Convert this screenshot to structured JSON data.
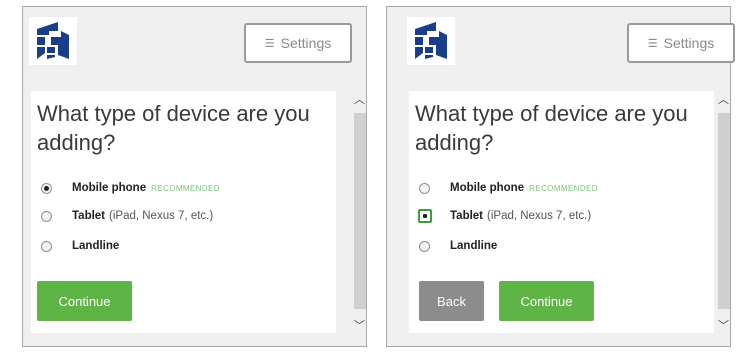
{
  "colors": {
    "primary_button": "#5fb446",
    "back_button": "#8c8c8c",
    "recommended_text": "#7cc47c",
    "logo_blue": "#1a3e8a"
  },
  "logo": {
    "icon": "duo-logo-icon"
  },
  "settings": {
    "label": "Settings",
    "icon": "menu-icon"
  },
  "question": "What type of device are you adding?",
  "options": [
    {
      "name": "Mobile phone",
      "tag": "RECOMMENDED"
    },
    {
      "name": "Tablet",
      "hint": "(iPad, Nexus 7, etc.)"
    },
    {
      "name": "Landline"
    }
  ],
  "scroll": {
    "up_icon": "chevron-up-icon",
    "down_icon": "chevron-down-icon"
  },
  "panels": [
    {
      "selected": "Mobile phone",
      "buttons": {
        "continue": "Continue"
      }
    },
    {
      "selected": "Tablet",
      "buttons": {
        "back": "Back",
        "continue": "Continue"
      }
    }
  ]
}
